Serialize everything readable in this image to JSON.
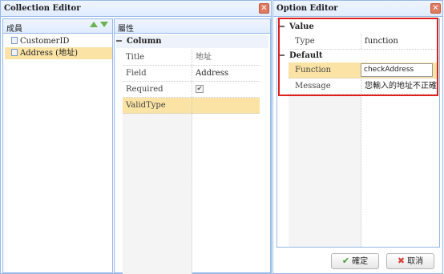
{
  "collection_editor": {
    "title": "Collection Editor",
    "close_glyph": "✕",
    "members_header": "成員",
    "members": [
      {
        "label": "CustomerID",
        "icon": "document-icon"
      },
      {
        "label": "Address (地址)",
        "icon": "document-icon"
      }
    ],
    "props_header": "屬性",
    "group_label": "Column",
    "properties": [
      {
        "name": "Title",
        "value": "地址"
      },
      {
        "name": "Field",
        "value": "Address"
      },
      {
        "name": "Required",
        "value": "✔"
      },
      {
        "name": "ValidType",
        "value": ""
      }
    ]
  },
  "option_editor": {
    "title": "Option Editor",
    "close_glyph": "✕",
    "groups": [
      {
        "label": "Value",
        "rows": [
          {
            "name": "Type",
            "value": "function"
          }
        ]
      },
      {
        "label": "Default",
        "rows": [
          {
            "name": "Function",
            "value": "checkAddress"
          },
          {
            "name": "Message",
            "value": "您輸入的地址不正確"
          }
        ]
      }
    ],
    "ok_label": "確定",
    "ok_icon": "✔",
    "cancel_label": "取消",
    "cancel_icon": "✖"
  },
  "colors": {
    "border": "#95b8e7",
    "header_bg": "#e0ecff",
    "selected_row": "#fbe3a5",
    "highlight_box": "#e0201b",
    "close_button": "#e07a5f",
    "ok_icon": "#3c9b2f",
    "cancel_icon": "#d9453a"
  }
}
